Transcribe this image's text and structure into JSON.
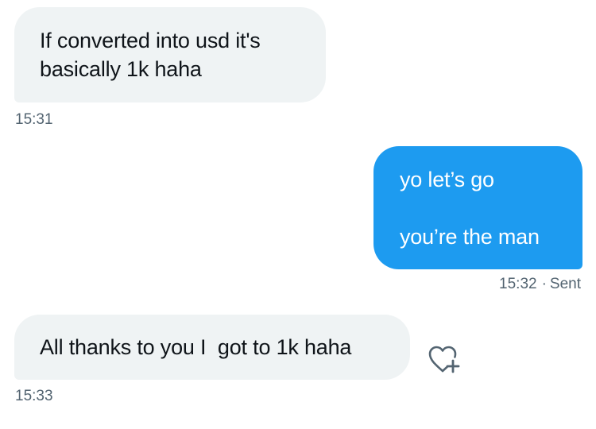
{
  "messages": [
    {
      "direction": "incoming",
      "lines": [
        "If converted into usd it's",
        "basically 1k haha"
      ],
      "time": "15:31"
    },
    {
      "direction": "outgoing",
      "lines": [
        "yo let’s go",
        "you’re the man"
      ],
      "time": "15:32",
      "status": "Sent",
      "separator": "·"
    },
    {
      "direction": "incoming",
      "lines": [
        "All thanks to you I  got to 1k haha"
      ],
      "time": "15:33",
      "action_icon": "heart-plus-icon"
    }
  ],
  "colors": {
    "incoming_bubble": "#eff3f4",
    "outgoing_bubble": "#1d9bf0",
    "outgoing_text": "#ffffff",
    "meta_text": "#536471",
    "icon": "#536471"
  }
}
